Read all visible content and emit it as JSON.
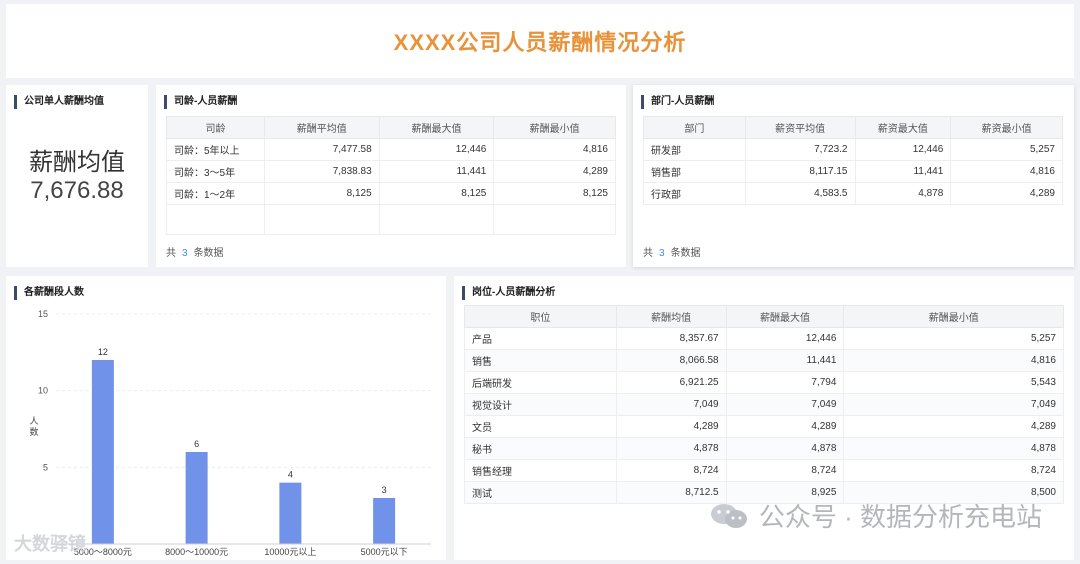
{
  "page_title": "XXXX公司人员薪酬情况分析",
  "kpi": {
    "title": "公司单人薪酬均值",
    "label": "薪酬均值",
    "value": "7,676.88"
  },
  "seniority": {
    "title": "司龄-人员薪酬",
    "columns": [
      "司龄",
      "薪酬平均值",
      "薪酬最大值",
      "薪酬最小值"
    ],
    "rows": [
      [
        "司龄：5年以上",
        "7,477.58",
        "12,446",
        "4,816"
      ],
      [
        "司龄：3～5年",
        "7,838.83",
        "11,441",
        "4,289"
      ],
      [
        "司龄：1～2年",
        "8,125",
        "8,125",
        "8,125"
      ]
    ],
    "footer_prefix": "共",
    "footer_count": "3",
    "footer_suffix": "条数据"
  },
  "department": {
    "title": "部门-人员薪酬",
    "columns": [
      "部门",
      "薪资平均值",
      "薪资最大值",
      "薪资最小值"
    ],
    "rows": [
      [
        "研发部",
        "7,723.2",
        "12,446",
        "5,257"
      ],
      [
        "销售部",
        "8,117.15",
        "11,441",
        "4,816"
      ],
      [
        "行政部",
        "4,583.5",
        "4,878",
        "4,289"
      ]
    ],
    "footer_prefix": "共",
    "footer_count": "3",
    "footer_suffix": "条数据"
  },
  "position": {
    "title": "岗位-人员薪酬分析",
    "columns": [
      "职位",
      "薪酬均值",
      "薪酬最大值",
      "薪酬最小值"
    ],
    "rows": [
      [
        "产品",
        "8,357.67",
        "12,446",
        "5,257"
      ],
      [
        "销售",
        "8,066.58",
        "11,441",
        "4,816"
      ],
      [
        "后端研发",
        "6,921.25",
        "7,794",
        "5,543"
      ],
      [
        "视觉设计",
        "7,049",
        "7,049",
        "7,049"
      ],
      [
        "文员",
        "4,289",
        "4,289",
        "4,289"
      ],
      [
        "秘书",
        "4,878",
        "4,878",
        "4,878"
      ],
      [
        "销售经理",
        "8,724",
        "8,724",
        "8,724"
      ],
      [
        "测试",
        "8,712.5",
        "8,925",
        "8,500"
      ]
    ]
  },
  "chart_title": "各薪酬段人数",
  "chart_data": {
    "type": "bar",
    "categories": [
      "5000～8000元",
      "8000～10000元",
      "10000元以上",
      "5000元以下"
    ],
    "values": [
      12,
      6,
      4,
      3
    ],
    "ylabel": "人数",
    "ylim": [
      0,
      15
    ],
    "yticks": [
      5,
      10,
      15
    ],
    "bar_color": "#7092e8",
    "grid": true
  },
  "watermark": {
    "text": "公众号 · 数据分析充电站",
    "left_text": "大数驿镜"
  },
  "colors": {
    "title": "#e8923a",
    "accent_bar": "#3c4a6b",
    "count_link": "#3a8ee6"
  }
}
